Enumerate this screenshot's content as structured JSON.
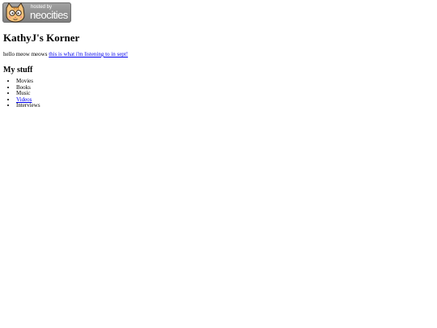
{
  "badge": {
    "hosted_label": "hosted by",
    "brand_label": "neocities",
    "colors": {
      "background": "#8f8f8f",
      "text": "#ffffff",
      "cat_fur": "#f3c27a",
      "cat_outline": "#3a2a1a"
    }
  },
  "page": {
    "title": "KathyJ's Korner",
    "intro_text": "hello meow meows",
    "intro_link_text": "this is what i'm listening to in sept!",
    "section_heading": "My stuff",
    "items": [
      {
        "label": "Movies",
        "is_link": false
      },
      {
        "label": "Books",
        "is_link": false
      },
      {
        "label": "Music",
        "is_link": false
      },
      {
        "label": "Videos",
        "is_link": true
      },
      {
        "label": "Interviews",
        "is_link": false
      }
    ]
  },
  "colors": {
    "link": "#0000ee",
    "text": "#000000",
    "background": "#ffffff"
  }
}
